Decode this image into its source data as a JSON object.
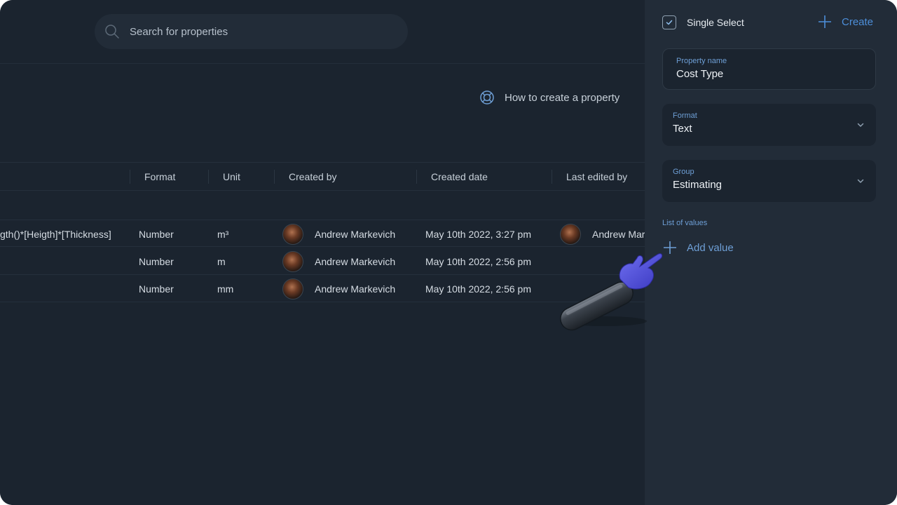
{
  "search": {
    "placeholder": "Search for properties",
    "icon": "search-icon"
  },
  "help": {
    "label": "How to create a property",
    "icon": "lifebuoy-icon"
  },
  "table": {
    "columns": [
      "Format",
      "Unit",
      "Created by",
      "Created date",
      "Last edited by"
    ],
    "rows": [
      {
        "formula": "gth()*[Heigth]*[Thickness]",
        "format": "Number",
        "unit": "m³",
        "created_by": "Andrew Markevich",
        "created_date": "May 10th 2022, 3:27 pm",
        "last_edited_by": "Andrew Mar"
      },
      {
        "formula": "",
        "format": "Number",
        "unit": "m",
        "created_by": "Andrew Markevich",
        "created_date": "May 10th 2022, 2:56 pm",
        "last_edited_by": ""
      },
      {
        "formula": "",
        "format": "Number",
        "unit": "mm",
        "created_by": "Andrew Markevich",
        "created_date": "May 10th 2022, 2:56 pm",
        "last_edited_by": ""
      }
    ]
  },
  "panel": {
    "type_label": "Single Select",
    "type_checked": true,
    "create_label": "Create",
    "property_name": {
      "label": "Property name",
      "value": "Cost Type"
    },
    "format": {
      "label": "Format",
      "value": "Text"
    },
    "group": {
      "label": "Group",
      "value": "Estimating"
    },
    "list_of_values_label": "List of values",
    "add_value_label": "Add value"
  },
  "colors": {
    "background": "#1b242f",
    "panel": "#222c38",
    "accent": "#4d8fda",
    "muted_accent": "#6e9fd6",
    "hand": "#4b4fd6"
  }
}
